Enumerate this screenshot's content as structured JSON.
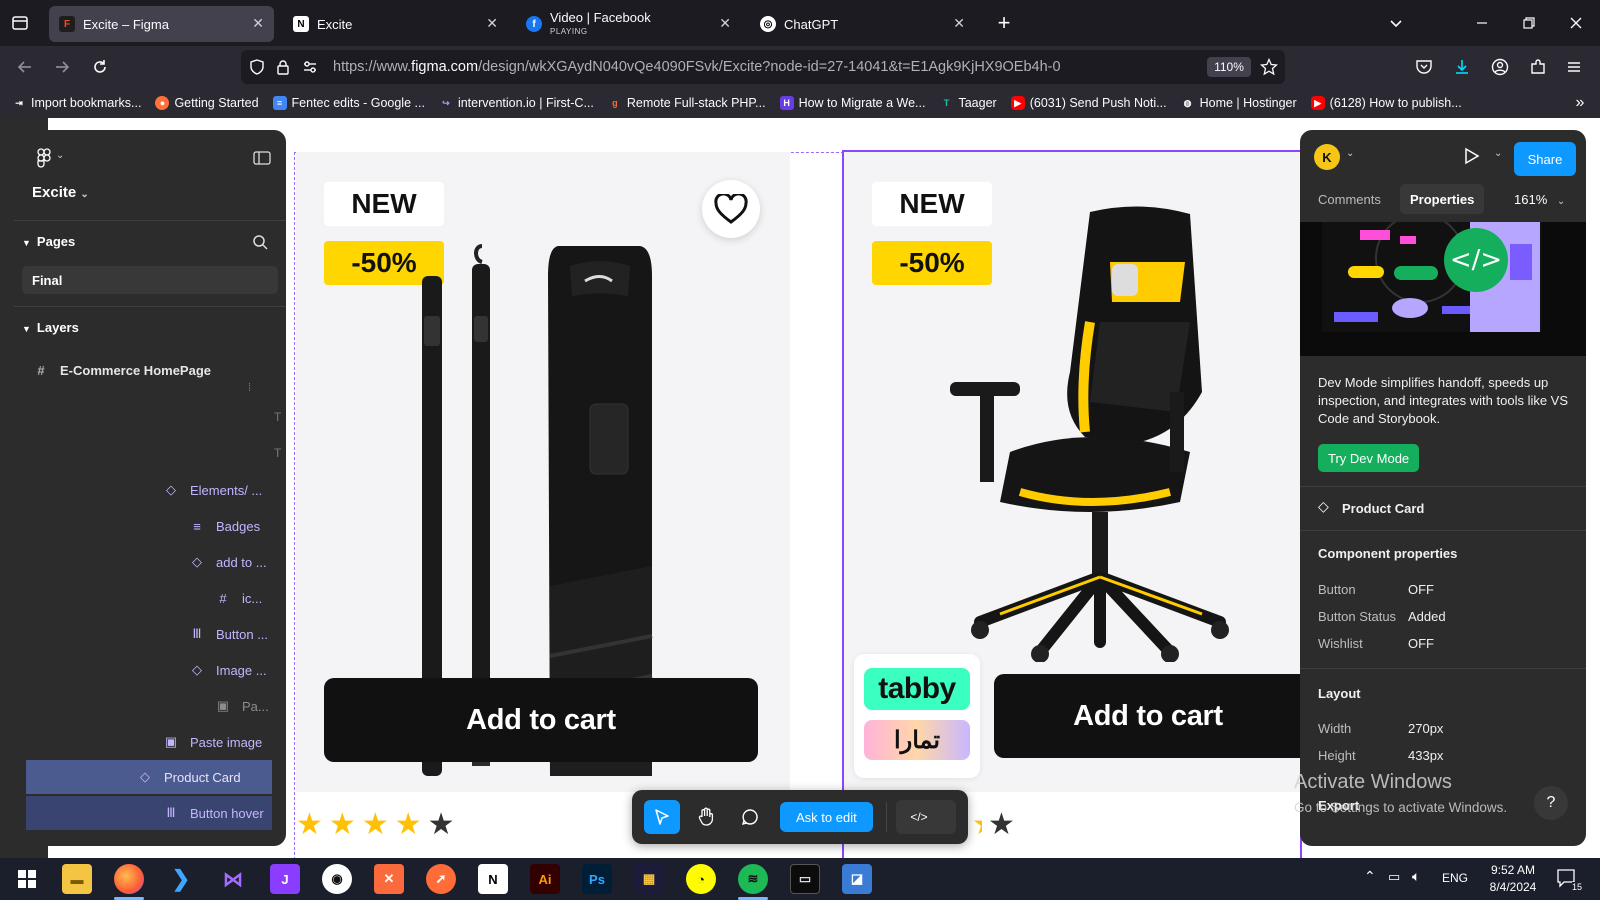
{
  "browser": {
    "tabs": [
      {
        "title": "Excite – Figma",
        "active": true,
        "icon": "figma-icon"
      },
      {
        "title": "Excite",
        "active": false,
        "icon": "notion-icon"
      },
      {
        "title": "Video | Facebook",
        "subtitle": "PLAYING",
        "active": false,
        "icon": "facebook-icon"
      },
      {
        "title": "ChatGPT",
        "active": false,
        "icon": "chatgpt-icon"
      }
    ],
    "url_prefix": "https://www.",
    "url_domain": "figma.com",
    "url_path": "/design/wkXGAydN040vQe4090FSvk/Excite?node-id=27-14041&t=E1Agk9KjHX9OEb4h-0",
    "zoom": "110%",
    "bookmarks": [
      {
        "label": "Import bookmarks...",
        "icon": "import-icon",
        "color": "#ffffff"
      },
      {
        "label": "Getting Started",
        "icon": "firefox-icon",
        "color": "#ff7139"
      },
      {
        "label": "Fentec edits - Google ...",
        "icon": "docs-icon",
        "color": "#4285f4"
      },
      {
        "label": "intervention.io | First-C...",
        "icon": "link-icon",
        "color": "#9aa0ff"
      },
      {
        "label": "Remote Full-stack PHP...",
        "icon": "remote-icon",
        "color": "#ff6b2c"
      },
      {
        "label": "How to Migrate a We...",
        "icon": "hostinger-icon",
        "color": "#673de6"
      },
      {
        "label": "Taager",
        "icon": "taager-icon",
        "color": "#22c3a6"
      },
      {
        "label": "(6031) Send Push Noti...",
        "icon": "youtube-icon",
        "color": "#ff0000"
      },
      {
        "label": "Home | Hostinger",
        "icon": "globe-icon",
        "color": "#ffffff"
      },
      {
        "label": "(6128) How to publish...",
        "icon": "youtube-icon",
        "color": "#ff0000"
      }
    ]
  },
  "figma": {
    "file_name": "Excite",
    "pages_label": "Pages",
    "current_page": "Final",
    "layers_label": "Layers",
    "layers": [
      {
        "label": "E-Commerce HomePage",
        "icon": "#",
        "kind": "frame"
      },
      {
        "label": "Elements/ ...",
        "icon": "◇",
        "kind": "component"
      },
      {
        "label": "Badges",
        "icon": "≡",
        "kind": "component"
      },
      {
        "label": "add to ...",
        "icon": "◇",
        "kind": "component"
      },
      {
        "label": "ic...",
        "icon": "#",
        "kind": "component"
      },
      {
        "label": "Button ...",
        "icon": "Ⅲ",
        "kind": "component"
      },
      {
        "label": "Image ...",
        "icon": "◇",
        "kind": "component"
      },
      {
        "label": "Pa...",
        "icon": "▣",
        "kind": "dim"
      },
      {
        "label": "Paste image",
        "icon": "▣",
        "kind": "component"
      },
      {
        "label": "Product Card",
        "icon": "◇",
        "kind": "selected"
      },
      {
        "label": "Button hover",
        "icon": "Ⅲ",
        "kind": "selected-light"
      }
    ],
    "right_panel": {
      "avatar_initial": "K",
      "share_label": "Share",
      "tab_comments": "Comments",
      "tab_properties": "Properties",
      "zoom": "161%",
      "devmode_text": "Dev Mode simplifies handoff, speeds up inspection, and integrates with tools like VS Code and Storybook.",
      "devmode_button": "Try Dev Mode",
      "component_name": "Product Card",
      "component_props_title": "Component properties",
      "component_props": [
        {
          "label": "Button",
          "value": "OFF"
        },
        {
          "label": "Button Status",
          "value": "Added"
        },
        {
          "label": "Wishlist",
          "value": "OFF"
        }
      ],
      "layout_title": "Layout",
      "layout": [
        {
          "label": "Width",
          "value": "270px"
        },
        {
          "label": "Height",
          "value": "433px"
        }
      ],
      "export_label": "Export",
      "help_label": "?"
    },
    "toolbar": {
      "ask_to_edit": "Ask to edit"
    }
  },
  "cards": [
    {
      "badge_new": "NEW",
      "badge_discount": "-50%",
      "button": "Add to cart",
      "rating": 4,
      "max_rating": 5
    },
    {
      "badge_new": "NEW",
      "badge_discount": "-50%",
      "button": "Add to cart",
      "tabby": "tabby",
      "tamara": "تمارا"
    }
  ],
  "windows": {
    "watermark_title": "Activate Windows",
    "watermark_sub": "Go to Settings to activate Windows.",
    "tray_lang": "ENG",
    "time": "9:52 AM",
    "date": "8/4/2024",
    "notifications": "15"
  },
  "colors": {
    "figma_accent": "#0d99ff",
    "selection": "#8a47ff",
    "badge_yellow": "#ffd600",
    "devmode_green": "#14ae5c"
  }
}
